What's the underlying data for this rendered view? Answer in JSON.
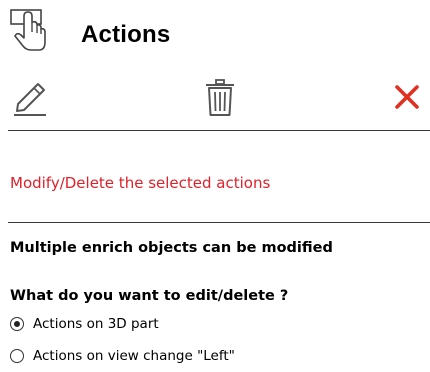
{
  "header": {
    "title": "Actions",
    "icon": "hand-pointer-icon"
  },
  "toolbar": {
    "edit_icon": "pencil-icon",
    "delete_icon": "trash-icon",
    "close_icon": "close-icon",
    "close_color": "#e03020"
  },
  "message": {
    "text": "Modify/Delete the selected actions",
    "color": "#e0202a"
  },
  "info_text": "Multiple enrich objects can be modified",
  "question": "What do you want to edit/delete ?",
  "options": [
    {
      "label": "Actions on 3D part",
      "selected": true
    },
    {
      "label": "Actions on view change \"Left\"",
      "selected": false
    }
  ]
}
